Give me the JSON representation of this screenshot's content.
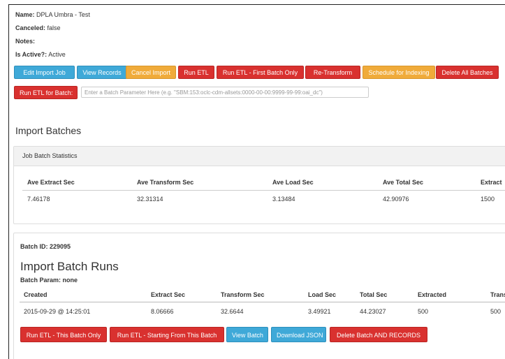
{
  "info": {
    "name_label": "Name:",
    "name_value": "DPLA Umbra - Test",
    "canceled_label": "Canceled:",
    "canceled_value": "false",
    "notes_label": "Notes:",
    "notes_value": "",
    "active_label": "Is Active?:",
    "active_value": "Active"
  },
  "toolbar": {
    "edit_import_job": "Edit Import Job",
    "view_records": "View Records",
    "cancel_import": "Cancel Import",
    "run_etl": "Run ETL",
    "run_etl_first_batch": "Run ETL - First Batch Only",
    "re_transform": "Re-Transform",
    "schedule_indexing": "Schedule for Indexing",
    "delete_all_batches": "Delete All Batches",
    "run_etl_for_batch": "Run ETL for Batch:",
    "batch_param_placeholder": "Enter a Batch Parameter Here (e.g. \"SBM:153:oclc-cdm-allsets:0000-00-00:9999-99-99:oai_dc\")"
  },
  "import_batches_title": "Import Batches",
  "stats": {
    "heading": "Job Batch Statistics",
    "columns": [
      "Ave Extract Sec",
      "Ave Transform Sec",
      "Ave Load Sec",
      "Ave Total Sec",
      "Extract"
    ],
    "values": [
      "7.46178",
      "32.31314",
      "3.13484",
      "42.90976",
      "1500"
    ]
  },
  "batch": {
    "id_label": "Batch ID: 229095",
    "runs_title": "Import Batch Runs",
    "param_label": "Batch Param: none",
    "columns": [
      "Created",
      "Extract Sec",
      "Transform Sec",
      "Load Sec",
      "Total Sec",
      "Extracted",
      "Trans"
    ],
    "row": [
      "2015-09-29 @ 14:25:01",
      "8.06666",
      "32.6644",
      "3.49921",
      "44.23027",
      "500",
      "500"
    ],
    "buttons": {
      "run_this_batch": "Run ETL - This Batch Only",
      "run_from_batch": "Run ETL - Starting From This Batch",
      "view_batch": "View Batch",
      "download_json": "Download JSON",
      "delete_batch_records": "Delete Batch AND RECORDS"
    }
  },
  "colors": {
    "blue": "#3fa9d8",
    "orange": "#f0ab3a",
    "red": "#d9312f"
  }
}
